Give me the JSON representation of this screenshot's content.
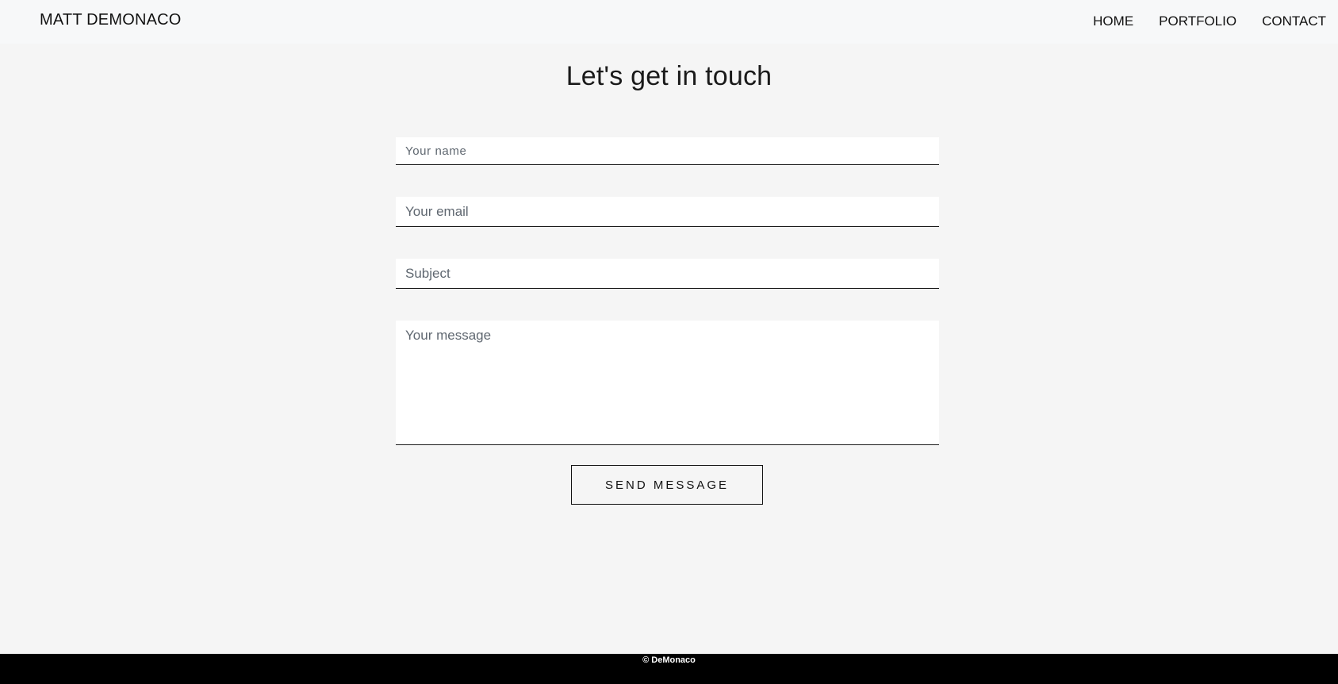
{
  "nav": {
    "brand": "MATT DEMONACO",
    "links": [
      "HOME",
      "PORTFOLIO",
      "CONTACT"
    ]
  },
  "contact": {
    "title": "Let's get in touch",
    "name_placeholder": "Your name",
    "email_placeholder": "Your email",
    "subject_placeholder": "Subject",
    "message_placeholder": "Your message",
    "send_label": "SEND MESSAGE"
  },
  "footer": {
    "text": "© DeMonaco"
  },
  "colors": {
    "page_bg": "#f5f5f5",
    "navbar_bg": "#f7f8f9",
    "footer_bg": "#000000",
    "field_bg": "#ffffff"
  }
}
